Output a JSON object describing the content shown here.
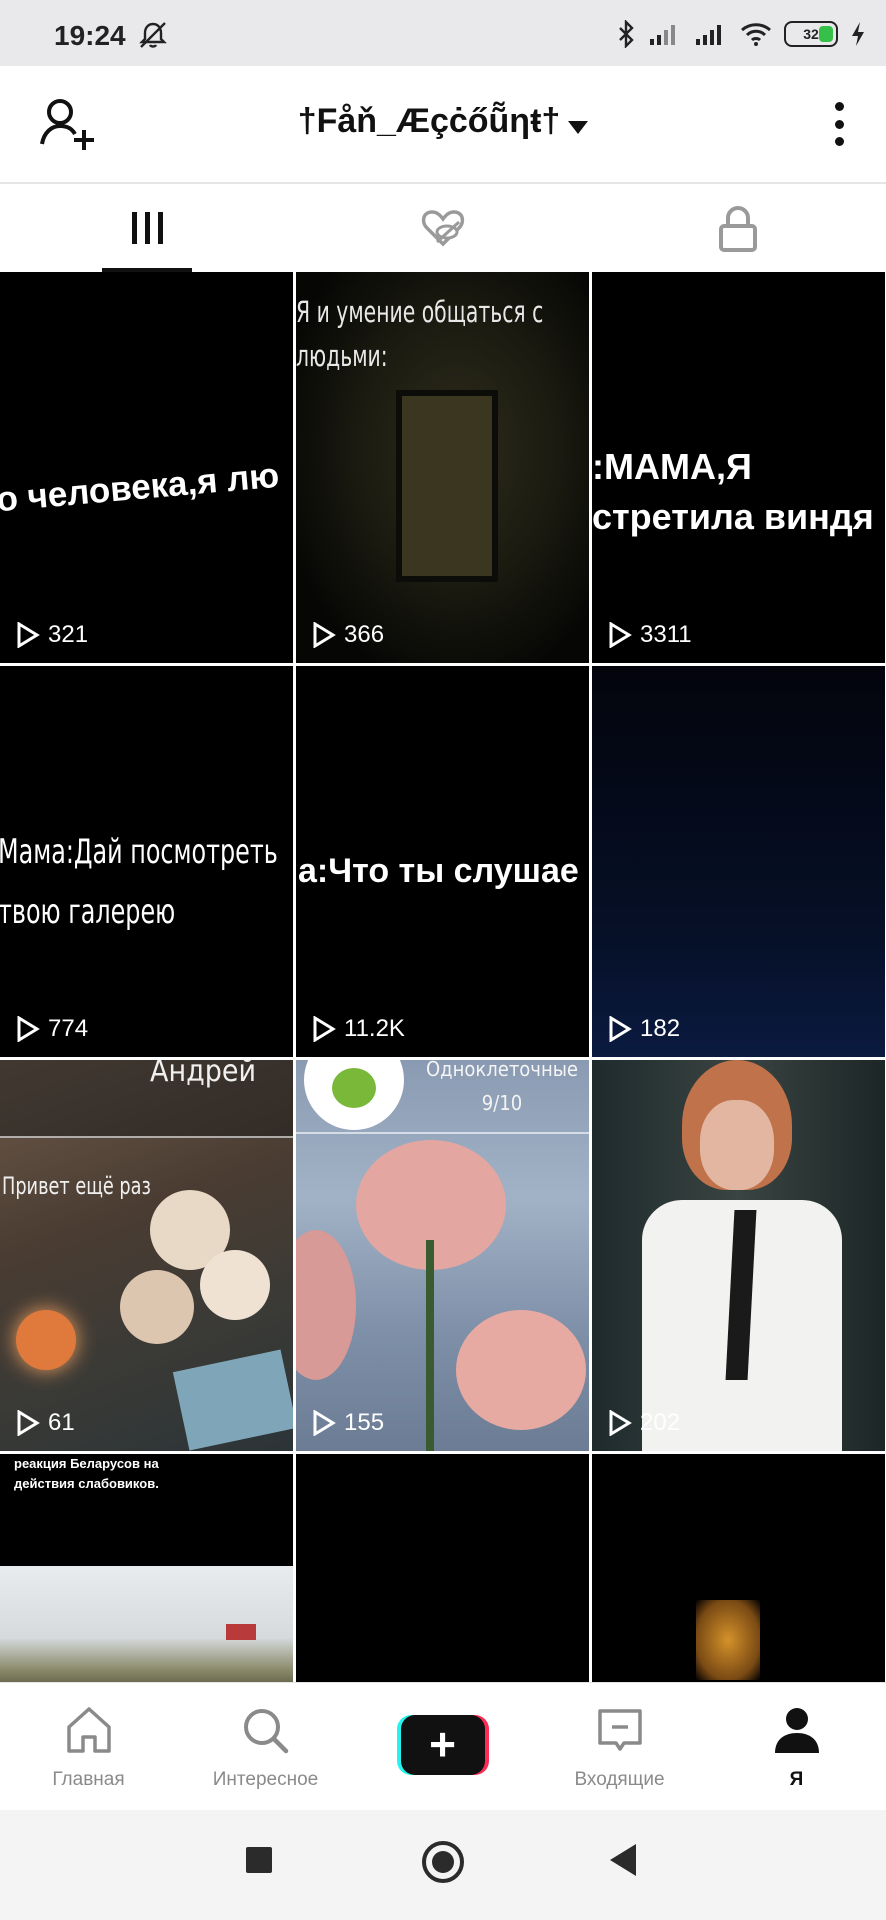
{
  "status_bar": {
    "time": "19:24",
    "battery": "32",
    "icons": [
      "bell-off-icon",
      "bluetooth-icon",
      "signal-icon",
      "signal-icon",
      "wifi-icon",
      "battery-icon",
      "charging-icon"
    ]
  },
  "header": {
    "username": "†Fåň_Æçċőũ̃ƞŧ†",
    "add_user_icon": "add-user-icon",
    "more_icon": "more-vertical-icon"
  },
  "tabs": [
    {
      "name": "videos",
      "icon": "grid-icon",
      "active": true
    },
    {
      "name": "liked",
      "icon": "heart-hidden-icon",
      "active": false
    },
    {
      "name": "private",
      "icon": "lock-icon",
      "active": false
    }
  ],
  "videos": [
    {
      "views": "321",
      "caption": "о человека,я лю"
    },
    {
      "views": "366",
      "caption": "Я и умение общаться с\nлюдьми:"
    },
    {
      "views": "3311",
      "caption": ":МАМА,Я\nстретила виндя"
    },
    {
      "views": "774",
      "caption": "Мама:Дай посмотреть\nтвою галерею"
    },
    {
      "views": "11.2K",
      "caption": "а:Что ты слушае"
    },
    {
      "views": "182",
      "caption": ""
    },
    {
      "views": "61",
      "caption": "Андрей",
      "caption2": "Привет ещё раз"
    },
    {
      "views": "155",
      "caption": "Одноклеточные\n9/10"
    },
    {
      "views": "202",
      "caption": ""
    },
    {
      "views": "",
      "caption": "реакция Беларусов на\nдействия слабовиков."
    },
    {
      "views": "",
      "caption": ""
    },
    {
      "views": "",
      "caption": ""
    }
  ],
  "bottom_nav": {
    "home": "Главная",
    "discover": "Интересное",
    "create": "+",
    "inbox": "Входящие",
    "me": "Я"
  },
  "colors": {
    "accent_cyan": "#25f4ee",
    "accent_red": "#fe2c55",
    "text": "#111111",
    "muted": "#8a8a8a"
  }
}
